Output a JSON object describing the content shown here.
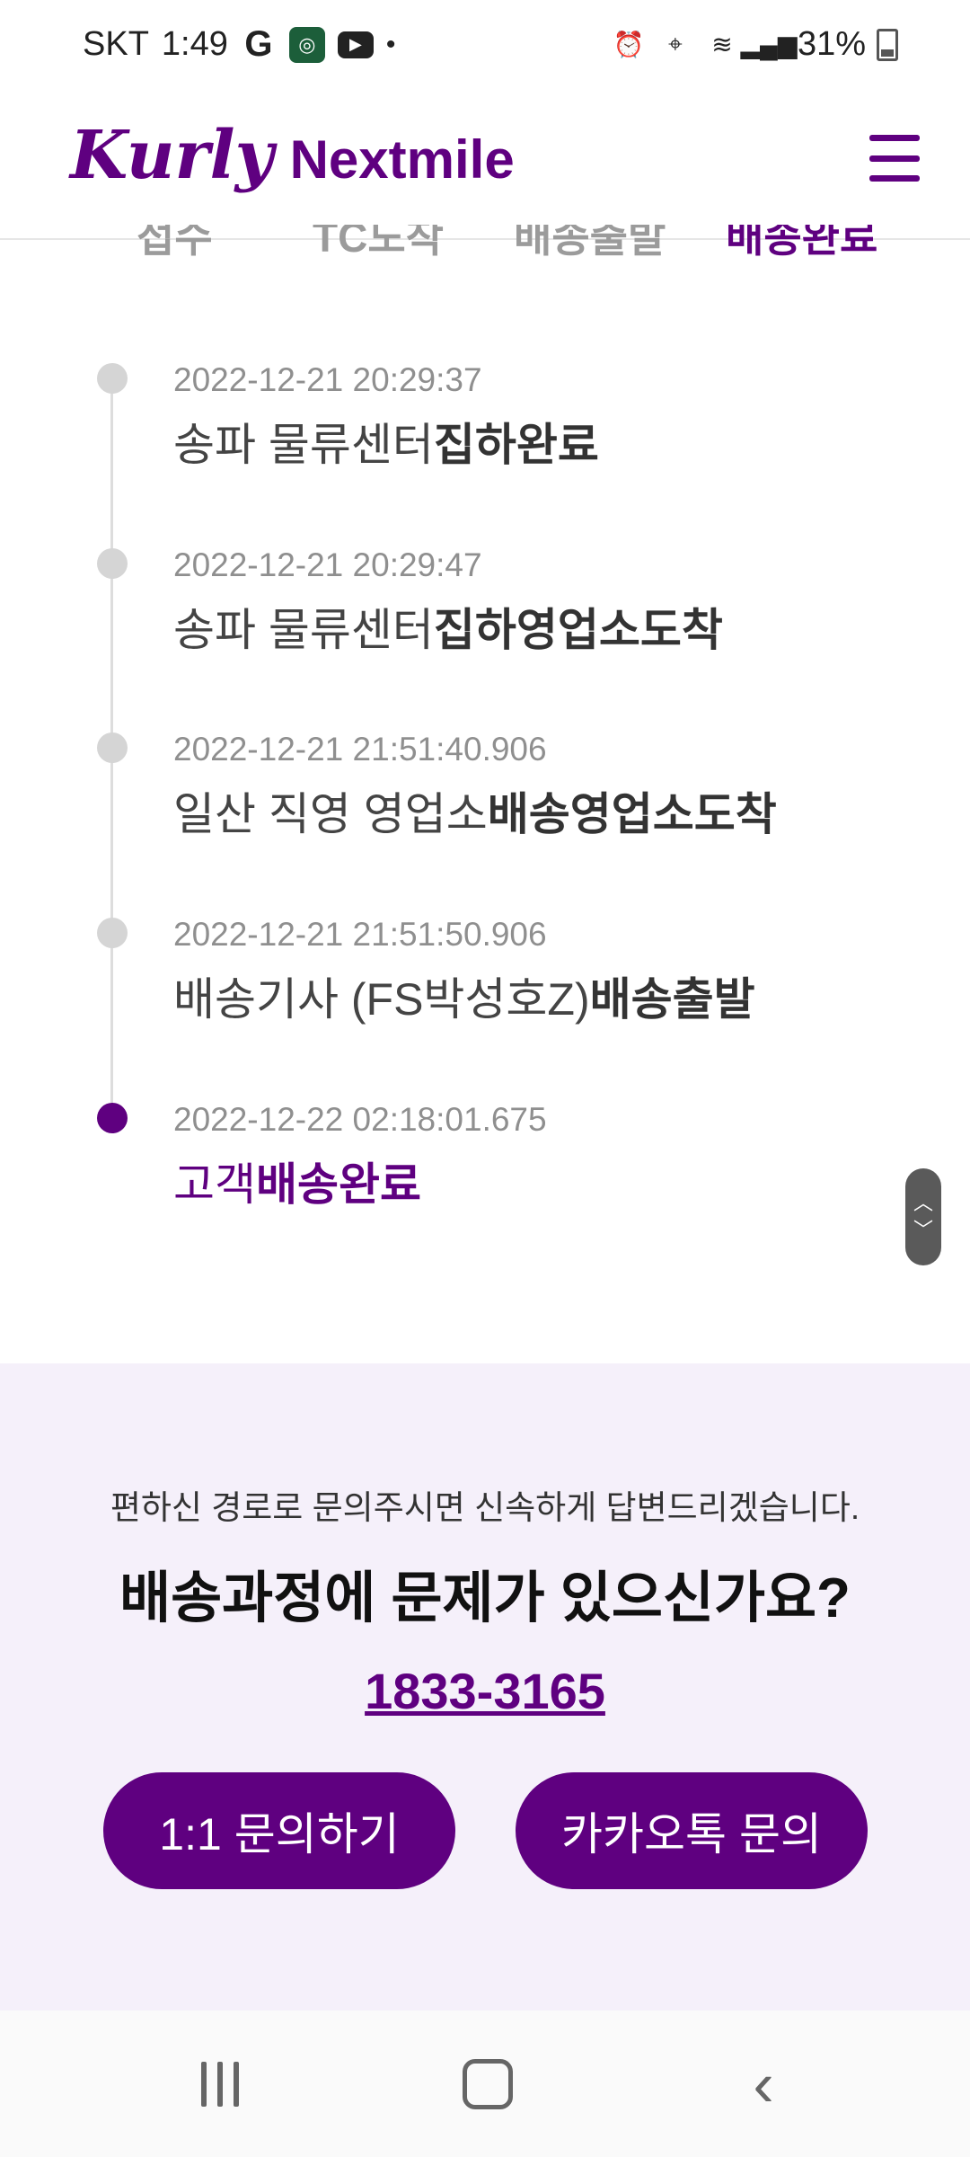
{
  "status_bar": {
    "carrier": "SKT",
    "time": "1:49",
    "battery": "31%"
  },
  "header": {
    "logo_script": "Kurly",
    "logo_text": "Nextmile"
  },
  "tabs": [
    "접수",
    "TC도착",
    "배송출발",
    "배송완료"
  ],
  "timeline": [
    {
      "time": "2022-12-21 20:29:37",
      "location": "송파 물류센터",
      "status": "집하완료",
      "done": false
    },
    {
      "time": "2022-12-21 20:29:47",
      "location": "송파 물류센터",
      "status": "집하영업소도착",
      "done": false
    },
    {
      "time": "2022-12-21 21:51:40.906",
      "location": "일산 직영 영업소",
      "status": "배송영업소도착",
      "done": false
    },
    {
      "time": "2022-12-21 21:51:50.906",
      "location": "배송기사 (FS박성호Z)",
      "status": "배송출발",
      "done": false
    },
    {
      "time": "2022-12-22 02:18:01.675",
      "location": "고객",
      "status": "배송완료",
      "done": true
    }
  ],
  "contact": {
    "subtitle": "편하신 경로로 문의주시면 신속하게 답변드리겠습니다.",
    "title": "배송과정에 문제가 있으신가요?",
    "phone": "1833-3165",
    "button_1": "1:1 문의하기",
    "button_2": "카카오톡 문의"
  },
  "colors": {
    "brand": "#5f0080",
    "contact_bg": "#f5f0fa",
    "inactive_dot": "#d5d5d5"
  }
}
